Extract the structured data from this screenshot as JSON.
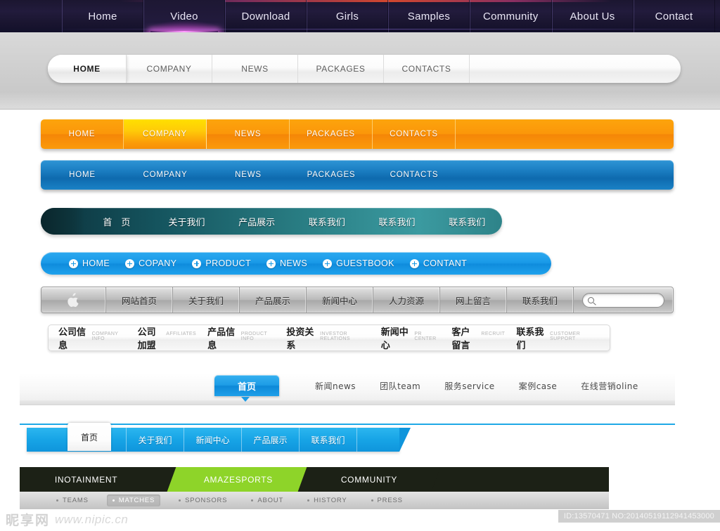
{
  "top_nav": {
    "items": [
      {
        "label": "Home",
        "active": false
      },
      {
        "label": "Video",
        "active": true
      },
      {
        "label": "Download",
        "active": false
      },
      {
        "label": "Girls",
        "active": false
      },
      {
        "label": "Samples",
        "active": false
      },
      {
        "label": "Community",
        "active": false
      },
      {
        "label": "About Us",
        "active": false
      },
      {
        "label": "Contact",
        "active": false
      }
    ],
    "accent_glow": "#ff9bff",
    "background": "#1b1630"
  },
  "white_pill_nav": {
    "items": [
      {
        "label": "HOME",
        "active": true
      },
      {
        "label": "COMPANY",
        "active": false
      },
      {
        "label": "NEWS",
        "active": false
      },
      {
        "label": "PACKAGES",
        "active": false
      },
      {
        "label": "CONTACTS",
        "active": false
      }
    ]
  },
  "orange_bar": {
    "accent": "#fb970a",
    "active_accent": "#ffe000",
    "items": [
      {
        "label": "HOME",
        "active": false
      },
      {
        "label": "COMPANY",
        "active": true
      },
      {
        "label": "NEWS",
        "active": false
      },
      {
        "label": "PACKAGES",
        "active": false
      },
      {
        "label": "CONTACTS",
        "active": false
      }
    ]
  },
  "blue_bar": {
    "accent": "#1b7ec2",
    "items": [
      {
        "label": "HOME"
      },
      {
        "label": "COMPANY"
      },
      {
        "label": "NEWS"
      },
      {
        "label": "PACKAGES"
      },
      {
        "label": "CONTACTS"
      }
    ]
  },
  "teal_bar": {
    "accent": "#2a7f85",
    "items": [
      {
        "label": "首　页"
      },
      {
        "label": "关于我们"
      },
      {
        "label": "产品展示"
      },
      {
        "label": "联系我们"
      },
      {
        "label": "联系我们"
      },
      {
        "label": "联系我们"
      }
    ]
  },
  "blue_pill_nav": {
    "accent": "#1a9ae8",
    "items": [
      {
        "label": "HOME",
        "icon": "plus-circle-icon"
      },
      {
        "label": "COPANY",
        "icon": "plus-circle-icon"
      },
      {
        "label": "PRODUCT",
        "icon": "plus-circle-icon"
      },
      {
        "label": "NEWS",
        "icon": "plus-circle-icon"
      },
      {
        "label": "GUESTBOOK",
        "icon": "plus-circle-icon"
      },
      {
        "label": "CONTANT",
        "icon": "plus-circle-icon"
      }
    ]
  },
  "apple_bar": {
    "logo_icon": "apple-logo-icon",
    "logo_glyph": "\u0001",
    "items": [
      {
        "label": "网站首页"
      },
      {
        "label": "关于我们"
      },
      {
        "label": "产品展示"
      },
      {
        "label": "新闻中心"
      },
      {
        "label": "人力资源"
      },
      {
        "label": "网上留言"
      },
      {
        "label": "联系我们"
      }
    ],
    "search": {
      "icon": "search-icon",
      "placeholder": "",
      "value": ""
    }
  },
  "bilingual_bar": {
    "items": [
      {
        "cn": "公司信息",
        "en": "COMPANY INFO"
      },
      {
        "cn": "公司加盟",
        "en": "AFFILIATES"
      },
      {
        "cn": "产品信息",
        "en": "PRODUCT INFO"
      },
      {
        "cn": "投资关系",
        "en": "INVESTOR RELATIONS"
      },
      {
        "cn": "新闻中心",
        "en": "PR CENTER"
      },
      {
        "cn": "客户留言",
        "en": "RECRUIT"
      },
      {
        "cn": "联系我们",
        "en": "CUSTOMER SUPPORT"
      }
    ]
  },
  "tab_row": {
    "home_label": "首页",
    "caret_icon": "caret-down-icon",
    "items": [
      {
        "label": "新闻news"
      },
      {
        "label": "团队team"
      },
      {
        "label": "服务service"
      },
      {
        "label": "案例case"
      },
      {
        "label": "在线营销oline"
      }
    ]
  },
  "cyan_bar": {
    "accent": "#17a4e6",
    "active_label": "首页",
    "items": [
      {
        "label": "关于我们"
      },
      {
        "label": "新闻中心"
      },
      {
        "label": "产品展示"
      },
      {
        "label": "联系我们"
      }
    ]
  },
  "sports_bar": {
    "dark": "#1c2116",
    "green": "#8ed429",
    "tabs": [
      {
        "label": "INOTAINMENT",
        "active": false
      },
      {
        "label": "AMAZESPORTS",
        "active": true
      },
      {
        "label": "COMMUNITY",
        "active": false
      }
    ],
    "sub_items": [
      {
        "label": "TEAMS",
        "active": false
      },
      {
        "label": "MATCHES",
        "active": true
      },
      {
        "label": "SPONSORS",
        "active": false
      },
      {
        "label": "ABOUT",
        "active": false
      },
      {
        "label": "HISTORY",
        "active": false
      },
      {
        "label": "PRESS",
        "active": false
      }
    ]
  },
  "watermark": {
    "brand_cn": "昵享网",
    "url": "www.nipic.cn",
    "id_text": "ID:13570471 NO:20140519112941453000"
  }
}
